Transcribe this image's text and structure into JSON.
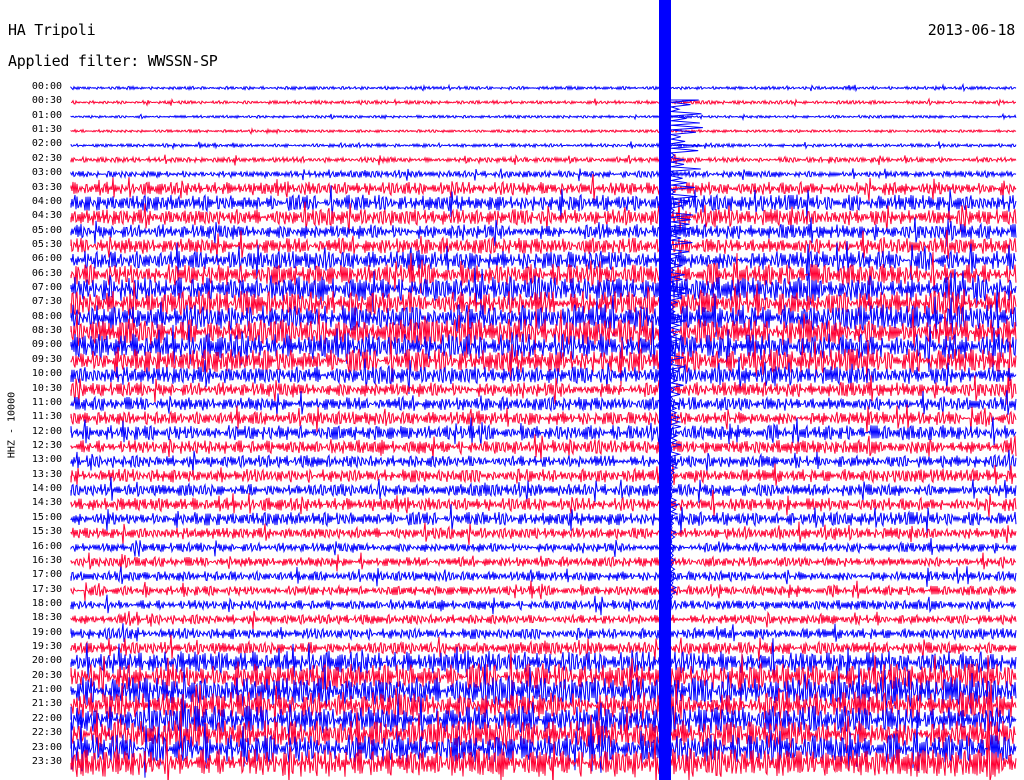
{
  "header": {
    "station": "HA Tripoli",
    "filter_text": "Applied filter: WWSSN-SP",
    "date": "2013-06-18"
  },
  "chart_data": {
    "type": "line",
    "title": "HA Tripoli",
    "ylabel": "HHZ - 10000",
    "xlabel": "",
    "colors": [
      "#0000ff",
      "#ff0033"
    ],
    "rows": [
      {
        "time": "00:00",
        "level": 0.05
      },
      {
        "time": "00:30",
        "level": 0.06
      },
      {
        "time": "01:00",
        "level": 0.03
      },
      {
        "time": "01:30",
        "level": 0.03
      },
      {
        "time": "02:00",
        "level": 0.06
      },
      {
        "time": "02:30",
        "level": 0.12
      },
      {
        "time": "03:00",
        "level": 0.18
      },
      {
        "time": "03:30",
        "level": 0.45
      },
      {
        "time": "04:00",
        "level": 0.55
      },
      {
        "time": "04:30",
        "level": 0.55
      },
      {
        "time": "05:00",
        "level": 0.5
      },
      {
        "time": "05:30",
        "level": 0.55
      },
      {
        "time": "06:00",
        "level": 0.65
      },
      {
        "time": "06:30",
        "level": 0.75
      },
      {
        "time": "07:00",
        "level": 0.85
      },
      {
        "time": "07:30",
        "level": 0.9
      },
      {
        "time": "08:00",
        "level": 0.95
      },
      {
        "time": "08:30",
        "level": 0.95
      },
      {
        "time": "09:00",
        "level": 0.95
      },
      {
        "time": "09:30",
        "level": 0.85
      },
      {
        "time": "10:00",
        "level": 0.6
      },
      {
        "time": "10:30",
        "level": 0.5
      },
      {
        "time": "11:00",
        "level": 0.45
      },
      {
        "time": "11:30",
        "level": 0.45
      },
      {
        "time": "12:00",
        "level": 0.5
      },
      {
        "time": "12:30",
        "level": 0.45
      },
      {
        "time": "13:00",
        "level": 0.4
      },
      {
        "time": "13:30",
        "level": 0.45
      },
      {
        "time": "14:00",
        "level": 0.4
      },
      {
        "time": "14:30",
        "level": 0.45
      },
      {
        "time": "15:00",
        "level": 0.45
      },
      {
        "time": "15:30",
        "level": 0.35
      },
      {
        "time": "16:00",
        "level": 0.3
      },
      {
        "time": "16:30",
        "level": 0.3
      },
      {
        "time": "17:00",
        "level": 0.3
      },
      {
        "time": "17:30",
        "level": 0.3
      },
      {
        "time": "18:00",
        "level": 0.3
      },
      {
        "time": "18:30",
        "level": 0.3
      },
      {
        "time": "19:00",
        "level": 0.35
      },
      {
        "time": "19:30",
        "level": 0.4
      },
      {
        "time": "20:00",
        "level": 0.8
      },
      {
        "time": "20:30",
        "level": 0.95
      },
      {
        "time": "21:00",
        "level": 1.0
      },
      {
        "time": "21:30",
        "level": 1.0
      },
      {
        "time": "22:00",
        "level": 1.0
      },
      {
        "time": "22:30",
        "level": 1.0
      },
      {
        "time": "23:00",
        "level": 1.0
      },
      {
        "time": "23:30",
        "level": 1.0
      }
    ]
  }
}
